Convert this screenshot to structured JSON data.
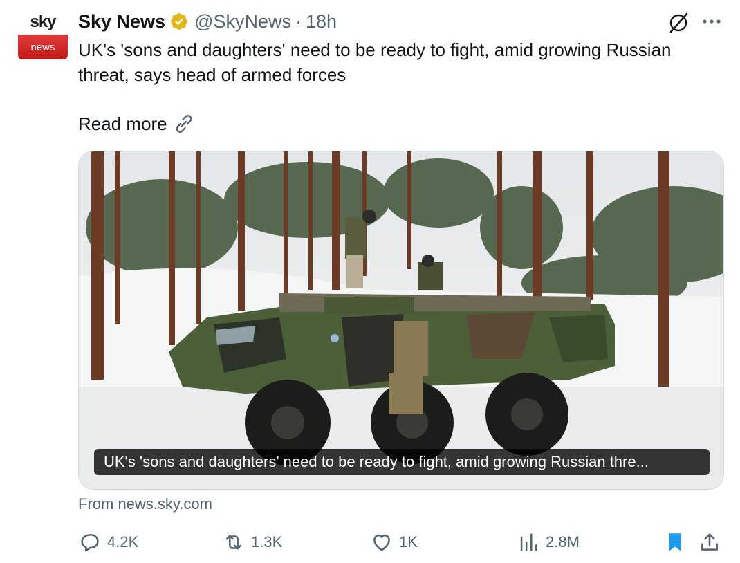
{
  "tweet": {
    "author": {
      "name": "Sky News",
      "handle": "@SkyNews",
      "separator": "·",
      "time": "18h",
      "avatar_top": "sky",
      "avatar_bottom": "news",
      "verified_badge_color": "#e2b719"
    },
    "text": "UK's 'sons and daughters' need to be ready to fight, amid growing Russian threat, says head of armed forces",
    "read_more": "Read more",
    "card": {
      "caption": "UK's 'sons and daughters' need to be ready to fight, amid growing Russian thre...",
      "source": "From news.sky.com"
    },
    "stats": {
      "replies": "4.2K",
      "reposts": "1.3K",
      "likes": "1K",
      "views": "2.8M"
    }
  },
  "icons": {
    "grok": "grok-icon",
    "more": "more-dots-icon",
    "link": "link-icon",
    "reply": "reply-icon",
    "repost": "repost-icon",
    "like": "heart-icon",
    "views": "views-icon",
    "bookmark": "bookmark-icon",
    "share": "share-icon"
  },
  "colors": {
    "text": "#0f1419",
    "secondary": "#536471",
    "bookmark_active": "#1d9bf0",
    "avatar_red": "#d42a2a"
  }
}
